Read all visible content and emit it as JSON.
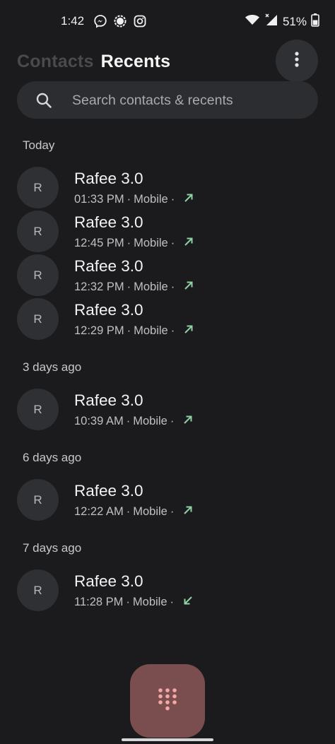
{
  "status_bar": {
    "time": "1:42",
    "battery_percent": "51%",
    "icons": [
      "messenger-icon",
      "signal-app-icon",
      "instagram-icon",
      "wifi-icon",
      "cell-signal-icon",
      "battery-icon"
    ]
  },
  "header": {
    "tabs": [
      {
        "label": "Contacts",
        "active": false
      },
      {
        "label": "Recents",
        "active": true
      }
    ],
    "overflow_icon": "more-vert-icon"
  },
  "search": {
    "placeholder": "Search contacts & recents",
    "value": ""
  },
  "sections": [
    {
      "title": "Today",
      "calls": [
        {
          "avatar": "R",
          "name": "Rafee 3.0",
          "time": "01:33 PM",
          "type": "Mobile",
          "direction": "outgoing"
        },
        {
          "avatar": "R",
          "name": "Rafee 3.0",
          "time": "12:45 PM",
          "type": "Mobile",
          "direction": "outgoing"
        },
        {
          "avatar": "R",
          "name": "Rafee 3.0",
          "time": "12:32 PM",
          "type": "Mobile",
          "direction": "outgoing"
        },
        {
          "avatar": "R",
          "name": "Rafee 3.0",
          "time": "12:29 PM",
          "type": "Mobile",
          "direction": "outgoing"
        }
      ]
    },
    {
      "title": "3 days ago",
      "calls": [
        {
          "avatar": "R",
          "name": "Rafee 3.0",
          "time": "10:39 AM",
          "type": "Mobile",
          "direction": "outgoing"
        }
      ]
    },
    {
      "title": "6 days ago",
      "calls": [
        {
          "avatar": "R",
          "name": "Rafee 3.0",
          "time": "12:22 AM",
          "type": "Mobile",
          "direction": "outgoing"
        }
      ]
    },
    {
      "title": "7 days ago",
      "calls": [
        {
          "avatar": "R",
          "name": "Rafee 3.0",
          "time": "11:28 PM",
          "type": "Mobile",
          "direction": "incoming"
        }
      ]
    }
  ],
  "fab": {
    "icon": "dialpad-icon"
  },
  "colors": {
    "background": "#1b1b1d",
    "surface": "#2f3033",
    "call_arrow": "#8fd3a4",
    "fab": "#7a4e4e",
    "fab_icon": "#f4a7a7"
  }
}
